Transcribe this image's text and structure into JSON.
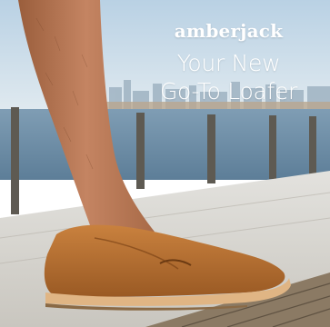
{
  "ad": {
    "brand": "amberjack",
    "headline_line1": "Your New",
    "headline_line2": "Go-To Loafer"
  },
  "colors": {
    "sky": "#c7dbe9",
    "water": "#6f8fa8",
    "shoe": "#b8702f",
    "sole": "#e2b98a",
    "boardwalk": "#d9d8d3",
    "text": "#ffffff"
  }
}
